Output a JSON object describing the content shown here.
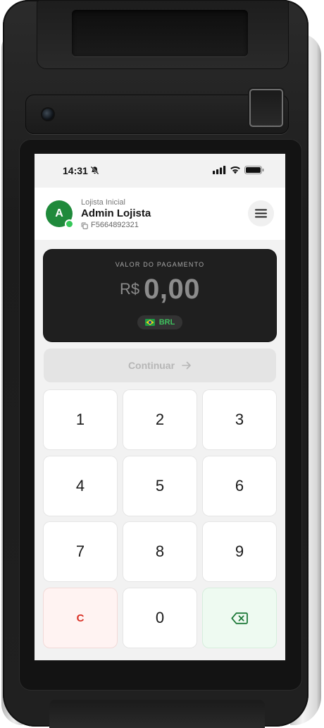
{
  "status_bar": {
    "time": "14:31"
  },
  "header": {
    "avatar_initial": "A",
    "store_label": "Lojista Inicial",
    "user_name": "Admin Lojista",
    "merchant_id": "F5664892321"
  },
  "payment": {
    "label": "VALOR DO PAGAMENTO",
    "currency_symbol": "R$",
    "amount": "0,00",
    "currency_code": "BRL"
  },
  "continue_button": {
    "label": "Continuar",
    "enabled": false
  },
  "keypad": {
    "keys": [
      "1",
      "2",
      "3",
      "4",
      "5",
      "6",
      "7",
      "8",
      "9",
      "C",
      "0"
    ]
  },
  "icons": {
    "status": [
      "bell-off-icon",
      "signal-icon",
      "wifi-icon",
      "battery-icon"
    ],
    "header": [
      "copy-icon",
      "menu-icon"
    ],
    "actions": [
      "arrow-right-icon",
      "backspace-icon",
      "brazil-flag-icon"
    ]
  },
  "colors": {
    "brand_green": "#1f8a3b",
    "status_online": "#35c759",
    "currency_green": "#3fbf5e",
    "clear_red": "#d93025",
    "card_dark": "#1f1f1f"
  }
}
